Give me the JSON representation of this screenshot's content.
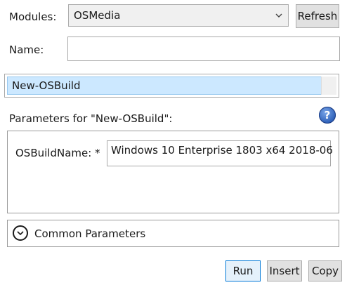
{
  "modules": {
    "label": "Modules:",
    "selected": "OSMedia",
    "refresh_label": "Refresh"
  },
  "name": {
    "label": "Name:",
    "value": ""
  },
  "command": {
    "selected": "New-OSBuild"
  },
  "parameters": {
    "header": "Parameters for \"New-OSBuild\":",
    "help_icon": "?",
    "fields": [
      {
        "label": "OSBuildName: *",
        "value": "Windows 10 Enterprise 1803 x64 2018-06"
      }
    ]
  },
  "common_parameters": {
    "label": "Common Parameters"
  },
  "actions": {
    "run_label": "Run",
    "insert_label": "Insert",
    "copy_label": "Copy"
  }
}
